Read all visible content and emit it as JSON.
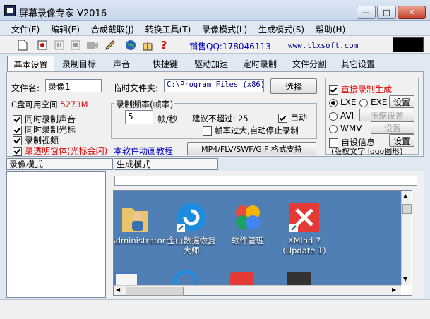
{
  "window": {
    "title": "屏幕录像专家 V2016",
    "minimize": "—",
    "maximize": "□",
    "close": "✕"
  },
  "menu": [
    "文件(F)",
    "编辑(E)",
    "合成截取(J)",
    "转换工具(T)",
    "录像模式(L)",
    "生成模式(S)",
    "帮助(H)"
  ],
  "toolbar": {
    "icons": [
      "new-file-icon",
      "record-icon",
      "pause-icon",
      "stop-icon",
      "camera-icon",
      "pen-icon",
      "globe-icon",
      "gift-icon",
      "help-icon"
    ],
    "sales_qq": "销售QQ:178046113",
    "website": "www.tlxsoft.com"
  },
  "tabs": [
    "基本设置",
    "录制目标",
    "声音",
    "快捷键",
    "驱动加速",
    "定时录制",
    "文件分割",
    "其它设置"
  ],
  "basic": {
    "filename_label": "文件名:",
    "filename_value": "录像1",
    "tempdir_label": "临时文件夹:",
    "tempdir_value": "C:\\Program Files (x86)\\",
    "select_button": "选择",
    "disk_space_label": "C盘可用空间:",
    "disk_space_value": "5273M",
    "checks": [
      {
        "label": "同时录制声音",
        "checked": true
      },
      {
        "label": "同时录制光标",
        "checked": true
      },
      {
        "label": "录制视频",
        "checked": true
      },
      {
        "label": "录透明窗体(光标会闪)",
        "checked": true
      }
    ],
    "anim_link": "本软件动画教程",
    "format_button": "MP4/FLV/SWF/GIF 格式支持",
    "framerate": {
      "group_title": "录制频率(帧率)",
      "value": "5",
      "unit": "帧/秒",
      "suggest_label": "建议不超过:",
      "suggest_value": "25",
      "auto_label": "自动",
      "auto_checked": true,
      "overload_label": "帧率过大,自动停止录制",
      "overload_checked": false
    },
    "direct": {
      "title": "直接录制生成",
      "checked": true,
      "formats": [
        {
          "label": "LXE",
          "selected": true
        },
        {
          "label": "EXE",
          "selected": false
        },
        {
          "label": "AVI",
          "selected": false
        },
        {
          "label": "WMV",
          "selected": false
        }
      ],
      "settings_button": "设置",
      "compress_button": "压缩设置",
      "settings2_button": "设置",
      "autoinfo_label": "自设信息",
      "autoinfo_checked": false,
      "autoinfo_button": "设置",
      "copyright_text": "(版权文字 logo图形)"
    }
  },
  "lower": {
    "left_tab": "录像模式",
    "right_tab": "生成模式",
    "desktop_icons": [
      {
        "name": "Administrator",
        "icon": "user-folder-icon"
      },
      {
        "name": "金山数据恢复大师",
        "icon": "recovery-icon"
      },
      {
        "name": "软件管理",
        "icon": "software-manager-icon"
      },
      {
        "name": "XMind 7 (Update 1)",
        "icon": "xmind-icon"
      }
    ]
  },
  "colors": {
    "accent_red": "#e00000",
    "link_blue": "#0000cc",
    "desk_blue": "#4f7fb5",
    "title_blue": "#c6d6ea"
  }
}
